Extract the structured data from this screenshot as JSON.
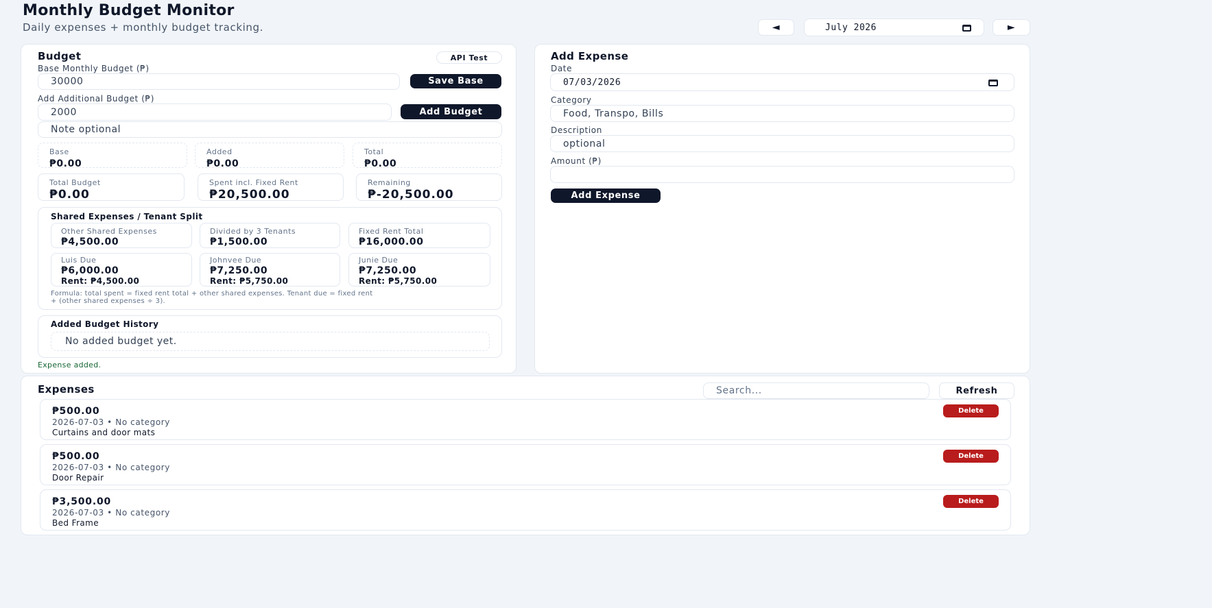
{
  "header": {
    "title": "Monthly Budget Monitor",
    "subtitle": "Daily expenses + monthly budget tracking.",
    "month_value": "July 2026"
  },
  "budget": {
    "title": "Budget",
    "api_test_label": "API Test",
    "base_label": "Base Monthly Budget (₱)",
    "base_value": "30000",
    "save_base_label": "Save Base",
    "additional_label": "Add Additional Budget (₱)",
    "additional_value": "2000",
    "add_budget_label": "Add Budget",
    "note_placeholder": "Note optional",
    "stats_row1": [
      {
        "key": "Base",
        "value": "₱0.00"
      },
      {
        "key": "Added",
        "value": "₱0.00"
      },
      {
        "key": "Total",
        "value": "₱0.00"
      }
    ],
    "stats_row2": [
      {
        "key": "Total Budget",
        "value": "₱0.00"
      },
      {
        "key": "Spent incl. Fixed Rent",
        "value": "₱20,500.00"
      },
      {
        "key": "Remaining",
        "value": "₱-20,500.00"
      }
    ],
    "shared": {
      "title": "Shared Expenses / Tenant Split",
      "row1": [
        {
          "key": "Other Shared Expenses",
          "value": "₱4,500.00"
        },
        {
          "key": "Divided by 3 Tenants",
          "value": "₱1,500.00"
        },
        {
          "key": "Fixed Rent Total",
          "value": "₱16,000.00"
        }
      ],
      "row2": [
        {
          "key": "Luis Due",
          "value": "₱6,000.00",
          "rent": "Rent: ₱4,500.00"
        },
        {
          "key": "Johnvee Due",
          "value": "₱7,250.00",
          "rent": "Rent: ₱5,750.00"
        },
        {
          "key": "Junie Due",
          "value": "₱7,250.00",
          "rent": "Rent: ₱5,750.00"
        }
      ],
      "formula_line1": "Formula: total spent = fixed rent total + other shared expenses. Tenant due = fixed rent",
      "formula_line2": "+ (other shared expenses ÷ 3)."
    },
    "history": {
      "title": "Added Budget History",
      "empty": "No added budget yet."
    },
    "status": "Expense added."
  },
  "add_expense": {
    "title": "Add Expense",
    "date_label": "Date",
    "date_value": "07/03/2026",
    "category_label": "Category",
    "category_placeholder": "Food, Transpo, Bills",
    "description_label": "Description",
    "description_placeholder": "optional",
    "amount_label": "Amount (₱)",
    "amount_value": "",
    "submit_label": "Add Expense"
  },
  "expenses": {
    "title": "Expenses",
    "search_placeholder": "Search...",
    "refresh_label": "Refresh",
    "delete_label": "Delete",
    "items": [
      {
        "amount": "₱500.00",
        "meta": "2026-07-03 • No category",
        "desc": "Curtains and door mats"
      },
      {
        "amount": "₱500.00",
        "meta": "2026-07-03 • No category",
        "desc": "Door Repair"
      },
      {
        "amount": "₱3,500.00",
        "meta": "2026-07-03 • No category",
        "desc": "Bed Frame"
      }
    ]
  }
}
